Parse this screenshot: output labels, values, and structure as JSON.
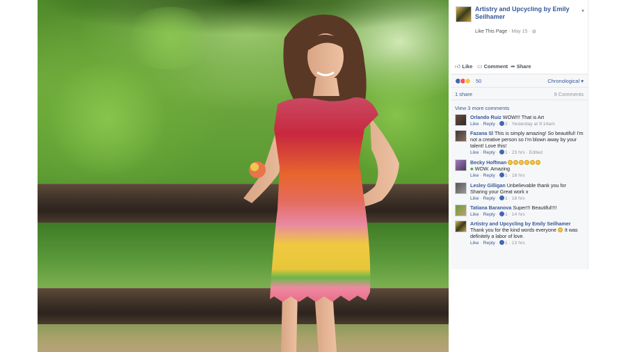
{
  "post": {
    "page_name": "Artistry and Upcycling by Emily Seilhamer",
    "like_page": "Like This Page",
    "date": "May 15",
    "separator": "·",
    "actions": {
      "like": "Like",
      "comment": "Comment",
      "share": "Share"
    },
    "reactions_count": "50",
    "sort_label": "Chronological",
    "sort_caret": "▾",
    "shares": "1 share",
    "comments_count": "9 Comments",
    "view_more": "View 3 more comments"
  },
  "comments": [
    {
      "author": "Orlando Ruiz",
      "text": "WOW!!! That is Art",
      "like": "Like",
      "reply": "Reply",
      "likes": "2",
      "time": "Yesterday at 8:14am"
    },
    {
      "author": "Fazana Sl",
      "text": "This is simply amazing! So beautiful! I'm not a creative person so I'm blown away by your talent! Love this!",
      "like": "Like",
      "reply": "Reply",
      "likes": "1",
      "time": "23 hrs",
      "edited": "Edited"
    },
    {
      "author": "Becky Hoffman",
      "text": "WOW. Amazing",
      "like": "Like",
      "reply": "Reply",
      "likes": "1",
      "time": "18 hrs"
    },
    {
      "author": "Lesley Gilligan",
      "text": "Unbelievable thank you for Sharing your Great work x",
      "like": "Like",
      "reply": "Reply",
      "likes": "1",
      "time": "18 hrs"
    },
    {
      "author": "Tatiana Baranova",
      "text": "Super!!! Beautiful!!!!",
      "like": "Like",
      "reply": "Reply",
      "likes": "1",
      "time": "14 hrs"
    },
    {
      "author": "Artistry and Upcycling by Emily Seilhamer",
      "text_before": "Thank you for the kind words everyone",
      "text_after": "It was definitely a labor of love.",
      "like": "Like",
      "reply": "Reply",
      "likes": "1",
      "time": "13 hrs"
    }
  ],
  "icons": {
    "like": "thumbs-up-icon",
    "comment": "comment-icon",
    "share": "share-arrow-icon",
    "globe": "globe-icon",
    "chevron": "chevron-down-icon"
  },
  "colors": {
    "link_blue": "#365899",
    "meta_gray": "#90949c",
    "like_blue": "#4267b2",
    "love_red": "#f25268",
    "wow_yellow": "#f7c543"
  }
}
